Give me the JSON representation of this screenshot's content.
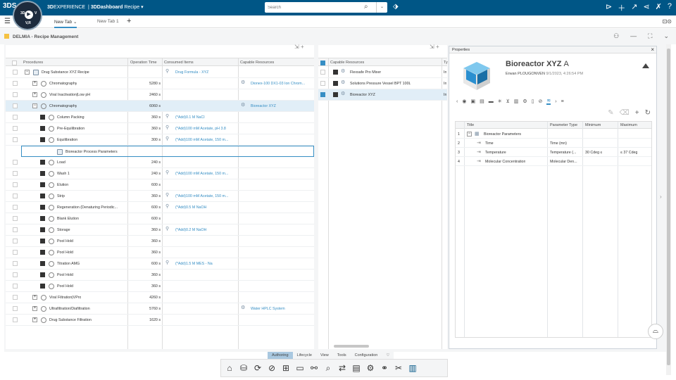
{
  "topbar": {
    "logo": "3DS",
    "compass": {
      "top": "3D",
      "right": "V",
      "bottom": "V,R",
      "play": "▶"
    },
    "brand_bold": "3D",
    "brand_normal": "EXPERIENCE",
    "brand_sep": "|",
    "brand_app": "3DDashboard",
    "brand_context": "Recipe",
    "search": {
      "placeholder": "Search"
    }
  },
  "tabs": [
    {
      "label": "New Tab"
    },
    {
      "label": "New Tab 1"
    }
  ],
  "app": {
    "title": "DELMIA - Recipe Management"
  },
  "procedures": {
    "headers": [
      "Procedures",
      "Operation Time",
      "Consumed Items",
      "Capable Resources"
    ],
    "rows": [
      {
        "name": "Drug Substance XYZ Recipe",
        "time": "",
        "consumed": "Drug Formula - XYZ",
        "resource": ""
      },
      {
        "name": "Chromatography",
        "time": "5280 s",
        "consumed": "",
        "resource": "Dionex-100 DX1-03 Ion Chrom..."
      },
      {
        "name": "Viral Inactivation|Low pH",
        "time": "2460 s",
        "consumed": "",
        "resource": ""
      },
      {
        "name": "Chromatography",
        "time": "6060 s",
        "consumed": "",
        "resource": "Bioreactor XYZ"
      },
      {
        "name": "Column Packing",
        "time": "360 s",
        "consumed": "(*Add)0.1 M NaCl",
        "resource": ""
      },
      {
        "name": "Pre-Equilibration",
        "time": "360 s",
        "consumed": "(*Add)100 mM Acetate, pH 3.8",
        "resource": ""
      },
      {
        "name": "Equilibration",
        "time": "300 s",
        "consumed": "(*Add)100 mM Acetate, 150 m...",
        "resource": ""
      },
      {
        "name": "Bioreactor Process Parameters",
        "time": "",
        "consumed": "",
        "resource": ""
      },
      {
        "name": "Load",
        "time": "240 s",
        "consumed": "",
        "resource": ""
      },
      {
        "name": "Wash 1",
        "time": "240 s",
        "consumed": "(*Add)100 mM Acetate, 150 m...",
        "resource": ""
      },
      {
        "name": "Elution",
        "time": "600 s",
        "consumed": "",
        "resource": ""
      },
      {
        "name": "Strip",
        "time": "360 s",
        "consumed": "(*Add)100 mM Acetate, 150 m...",
        "resource": ""
      },
      {
        "name": "Regeneration (Denaturing Periodic...",
        "time": "600 s",
        "consumed": "(*Add)0.5 M NaOH",
        "resource": ""
      },
      {
        "name": "Blank Elution",
        "time": "600 s",
        "consumed": "",
        "resource": ""
      },
      {
        "name": "Storage",
        "time": "360 s",
        "consumed": "(*Add)0.2 M NaOH",
        "resource": ""
      },
      {
        "name": "Pool Hold",
        "time": "360 s",
        "consumed": "",
        "resource": ""
      },
      {
        "name": "Pool Hold",
        "time": "360 s",
        "consumed": "",
        "resource": ""
      },
      {
        "name": "Titration AMG",
        "time": "600 s",
        "consumed": "(*Add)1.5 M MES - Na",
        "resource": ""
      },
      {
        "name": "Pool Hold",
        "time": "360 s",
        "consumed": "",
        "resource": ""
      },
      {
        "name": "Pool Hold",
        "time": "360 s",
        "consumed": "",
        "resource": ""
      },
      {
        "name": "Viral Filtration|VPro",
        "time": "4260 s",
        "consumed": "",
        "resource": ""
      },
      {
        "name": "Ultrafiltration/Diafiltration",
        "time": "5760 s",
        "consumed": "",
        "resource": "Water HPLC System"
      },
      {
        "name": "Drug Substance Filtration",
        "time": "1620 s",
        "consumed": "",
        "resource": ""
      }
    ]
  },
  "resources": {
    "headers": [
      "Capable Resources",
      "Ty"
    ],
    "rows": [
      {
        "name": "Flexsafe Pro Mixer",
        "type": "In"
      },
      {
        "name": "Solutions Pressure Vessel BPT 100L",
        "type": "In"
      },
      {
        "name": "Bioreactor XYZ",
        "type": "In"
      }
    ]
  },
  "properties": {
    "panel_title": "Properties",
    "name": "Bioreactor XYZ",
    "revision": "A",
    "owner": "Erwan PLOUGONVEN",
    "date": "9/1/2023, 4:26:54 PM",
    "table_headers": [
      "Title",
      "Parameter Type",
      "Minimum",
      "Maximum"
    ],
    "rows": [
      {
        "num": "1",
        "title": "Bioreactor Parameters",
        "ptype": "",
        "min": "",
        "max": ""
      },
      {
        "num": "2",
        "title": "Time",
        "ptype": "Time (mn)",
        "min": "",
        "max": ""
      },
      {
        "num": "3",
        "title": "Temperature",
        "ptype": "Temperature (...",
        "min": "30 Cdeg ≤",
        "max": "≤ 37 Cdeg"
      },
      {
        "num": "4",
        "title": "Molecular Concentration",
        "ptype": "Molecular Den...",
        "min": "",
        "max": ""
      }
    ]
  },
  "bottom_tabs": [
    "Authoring",
    "Lifecycle",
    "View",
    "Tools",
    "Configuration"
  ]
}
